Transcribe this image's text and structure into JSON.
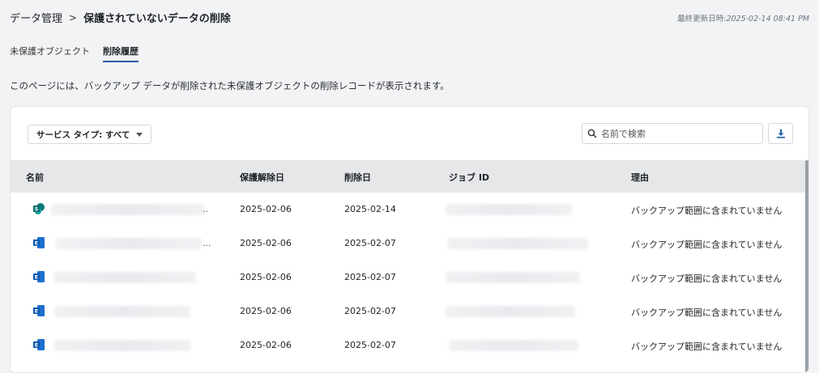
{
  "breadcrumb": {
    "parent": "データ管理",
    "separator": ">",
    "current": "保護されていないデータの削除"
  },
  "last_updated": {
    "label": "最終更新日時:",
    "value": "2025-02-14 08:41 PM"
  },
  "tabs": [
    {
      "label": "未保護オブジェクト"
    },
    {
      "label": "削除履歴"
    }
  ],
  "description": "このページには、バックアップ データが削除された未保護オブジェクトの削除レコードが表示されます。",
  "filter": {
    "label": "サービス タイプ: すべて"
  },
  "search": {
    "placeholder": "名前で検索"
  },
  "table": {
    "headers": {
      "name": "名前",
      "unprotected": "保護解除日",
      "deleted": "削除日",
      "job_id": "ジョブ ID",
      "reason": "理由"
    },
    "rows": [
      {
        "icon": "sharepoint-icon",
        "name_suffix": "..",
        "unprotected": "2025-02-06",
        "deleted": "2025-02-14",
        "reason": "バックアップ範囲に含まれていません"
      },
      {
        "icon": "exchange-icon",
        "name_suffix": "...",
        "unprotected": "2025-02-06",
        "deleted": "2025-02-07",
        "reason": "バックアップ範囲に含まれていません"
      },
      {
        "icon": "exchange-icon",
        "name_suffix": "",
        "unprotected": "2025-02-06",
        "deleted": "2025-02-07",
        "reason": "バックアップ範囲に含まれていません"
      },
      {
        "icon": "exchange-icon",
        "name_suffix": "",
        "unprotected": "2025-02-06",
        "deleted": "2025-02-07",
        "reason": "バックアップ範囲に含まれていません"
      },
      {
        "icon": "exchange-icon",
        "name_suffix": "",
        "unprotected": "2025-02-06",
        "deleted": "2025-02-07",
        "reason": "バックアップ範囲に含まれていません"
      }
    ]
  }
}
